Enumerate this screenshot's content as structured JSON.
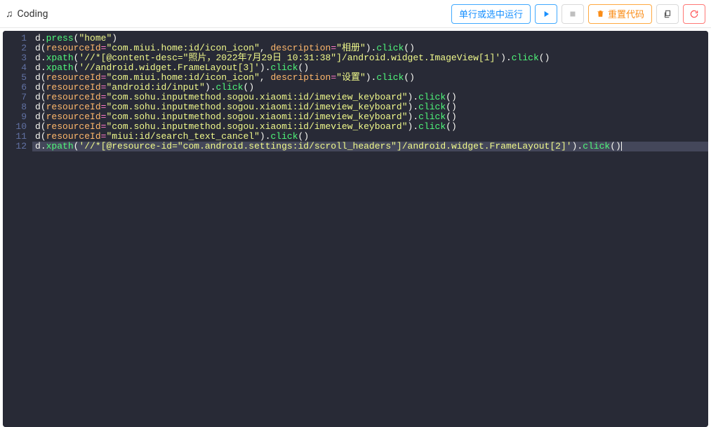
{
  "header": {
    "title": "Coding",
    "run_label": "单行或选中运行",
    "reset_label": "重置代码"
  },
  "code": {
    "lines": [
      [
        {
          "t": "id",
          "v": "d"
        },
        {
          "t": "paren",
          "v": "."
        },
        {
          "t": "method",
          "v": "press"
        },
        {
          "t": "paren",
          "v": "("
        },
        {
          "t": "str",
          "v": "\"home\""
        },
        {
          "t": "paren",
          "v": ")"
        }
      ],
      [
        {
          "t": "id",
          "v": "d"
        },
        {
          "t": "paren",
          "v": "("
        },
        {
          "t": "param",
          "v": "resourceId"
        },
        {
          "t": "op",
          "v": "="
        },
        {
          "t": "str",
          "v": "\"com.miui.home:id/icon_icon\""
        },
        {
          "t": "paren",
          "v": ", "
        },
        {
          "t": "param",
          "v": "description"
        },
        {
          "t": "op",
          "v": "="
        },
        {
          "t": "str",
          "v": "\"相册\""
        },
        {
          "t": "paren",
          "v": ")."
        },
        {
          "t": "method",
          "v": "click"
        },
        {
          "t": "paren",
          "v": "()"
        }
      ],
      [
        {
          "t": "id",
          "v": "d"
        },
        {
          "t": "paren",
          "v": "."
        },
        {
          "t": "method",
          "v": "xpath"
        },
        {
          "t": "paren",
          "v": "("
        },
        {
          "t": "str",
          "v": "'//*[@content-desc=\"照片，2022年7月29日 10:31:38\"]/android.widget.ImageView[1]'"
        },
        {
          "t": "paren",
          "v": ")."
        },
        {
          "t": "method",
          "v": "click"
        },
        {
          "t": "paren",
          "v": "()"
        }
      ],
      [
        {
          "t": "id",
          "v": "d"
        },
        {
          "t": "paren",
          "v": "."
        },
        {
          "t": "method",
          "v": "xpath"
        },
        {
          "t": "paren",
          "v": "("
        },
        {
          "t": "str",
          "v": "'//android.widget.FrameLayout[3]'"
        },
        {
          "t": "paren",
          "v": ")."
        },
        {
          "t": "method",
          "v": "click"
        },
        {
          "t": "paren",
          "v": "()"
        }
      ],
      [
        {
          "t": "id",
          "v": "d"
        },
        {
          "t": "paren",
          "v": "("
        },
        {
          "t": "param",
          "v": "resourceId"
        },
        {
          "t": "op",
          "v": "="
        },
        {
          "t": "str",
          "v": "\"com.miui.home:id/icon_icon\""
        },
        {
          "t": "paren",
          "v": ", "
        },
        {
          "t": "param",
          "v": "description"
        },
        {
          "t": "op",
          "v": "="
        },
        {
          "t": "str",
          "v": "\"设置\""
        },
        {
          "t": "paren",
          "v": ")."
        },
        {
          "t": "method",
          "v": "click"
        },
        {
          "t": "paren",
          "v": "()"
        }
      ],
      [
        {
          "t": "id",
          "v": "d"
        },
        {
          "t": "paren",
          "v": "("
        },
        {
          "t": "param",
          "v": "resourceId"
        },
        {
          "t": "op",
          "v": "="
        },
        {
          "t": "str",
          "v": "\"android:id/input\""
        },
        {
          "t": "paren",
          "v": ")."
        },
        {
          "t": "method",
          "v": "click"
        },
        {
          "t": "paren",
          "v": "()"
        }
      ],
      [
        {
          "t": "id",
          "v": "d"
        },
        {
          "t": "paren",
          "v": "("
        },
        {
          "t": "param",
          "v": "resourceId"
        },
        {
          "t": "op",
          "v": "="
        },
        {
          "t": "str",
          "v": "\"com.sohu.inputmethod.sogou.xiaomi:id/imeview_keyboard\""
        },
        {
          "t": "paren",
          "v": ")."
        },
        {
          "t": "method",
          "v": "click"
        },
        {
          "t": "paren",
          "v": "()"
        }
      ],
      [
        {
          "t": "id",
          "v": "d"
        },
        {
          "t": "paren",
          "v": "("
        },
        {
          "t": "param",
          "v": "resourceId"
        },
        {
          "t": "op",
          "v": "="
        },
        {
          "t": "str",
          "v": "\"com.sohu.inputmethod.sogou.xiaomi:id/imeview_keyboard\""
        },
        {
          "t": "paren",
          "v": ")."
        },
        {
          "t": "method",
          "v": "click"
        },
        {
          "t": "paren",
          "v": "()"
        }
      ],
      [
        {
          "t": "id",
          "v": "d"
        },
        {
          "t": "paren",
          "v": "("
        },
        {
          "t": "param",
          "v": "resourceId"
        },
        {
          "t": "op",
          "v": "="
        },
        {
          "t": "str",
          "v": "\"com.sohu.inputmethod.sogou.xiaomi:id/imeview_keyboard\""
        },
        {
          "t": "paren",
          "v": ")."
        },
        {
          "t": "method",
          "v": "click"
        },
        {
          "t": "paren",
          "v": "()"
        }
      ],
      [
        {
          "t": "id",
          "v": "d"
        },
        {
          "t": "paren",
          "v": "("
        },
        {
          "t": "param",
          "v": "resourceId"
        },
        {
          "t": "op",
          "v": "="
        },
        {
          "t": "str",
          "v": "\"com.sohu.inputmethod.sogou.xiaomi:id/imeview_keyboard\""
        },
        {
          "t": "paren",
          "v": ")."
        },
        {
          "t": "method",
          "v": "click"
        },
        {
          "t": "paren",
          "v": "()"
        }
      ],
      [
        {
          "t": "id",
          "v": "d"
        },
        {
          "t": "paren",
          "v": "("
        },
        {
          "t": "param",
          "v": "resourceId"
        },
        {
          "t": "op",
          "v": "="
        },
        {
          "t": "str",
          "v": "\"miui:id/search_text_cancel\""
        },
        {
          "t": "paren",
          "v": ")."
        },
        {
          "t": "method",
          "v": "click"
        },
        {
          "t": "paren",
          "v": "()"
        }
      ],
      [
        {
          "t": "id",
          "v": "d"
        },
        {
          "t": "paren",
          "v": "."
        },
        {
          "t": "method",
          "v": "xpath"
        },
        {
          "t": "paren",
          "v": "("
        },
        {
          "t": "str",
          "v": "'//*[@resource-id=\"com.android.settings:id/scroll_headers\"]/android.widget.FrameLayout[2]'"
        },
        {
          "t": "paren",
          "v": ")."
        },
        {
          "t": "method",
          "v": "click"
        },
        {
          "t": "paren",
          "v": "()"
        }
      ]
    ],
    "active_line": 12
  }
}
